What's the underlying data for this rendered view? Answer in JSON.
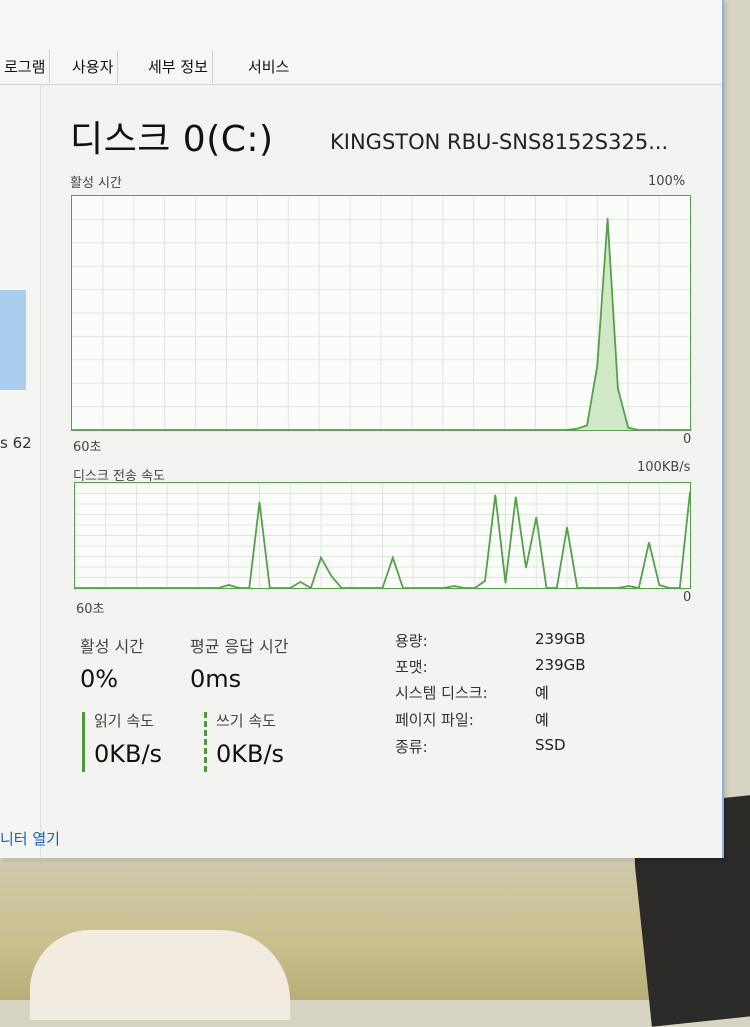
{
  "tabs": [
    "로그램",
    "사용자",
    "세부 정보",
    "서비스"
  ],
  "left_pane_text": "s 62",
  "header": {
    "title": "디스크 0(C:)",
    "model": "KINGSTON RBU-SNS8152S325..."
  },
  "activity_chart": {
    "label": "활성 시간",
    "max_label": "100%",
    "time_label": "60초",
    "min_label": "0"
  },
  "transfer_chart": {
    "label": "디스크 전송 속도",
    "max_label": "100KB/s",
    "time_label": "60초",
    "min_label": "0"
  },
  "chart_data": [
    {
      "type": "area",
      "title": "활성 시간",
      "unit": "%",
      "ylim": [
        0,
        100
      ],
      "x_range_label": "60초",
      "grid": true,
      "values": [
        0,
        0,
        0,
        0,
        0,
        0,
        0,
        0,
        0,
        0,
        0,
        0,
        0,
        0,
        0,
        0,
        0,
        0,
        0,
        0,
        0,
        0,
        0,
        0,
        0,
        0,
        0,
        0,
        0,
        0,
        0,
        0,
        0,
        0,
        0,
        0,
        0,
        0,
        0,
        0,
        0,
        0,
        0,
        0,
        0,
        0,
        0,
        0,
        0,
        0.5,
        2,
        28,
        92,
        18,
        1,
        0,
        0,
        0,
        0,
        0,
        0
      ]
    },
    {
      "type": "line",
      "title": "디스크 전송 속도",
      "unit": "KB/s",
      "ylim": [
        0,
        100
      ],
      "x_range_label": "60초",
      "grid": true,
      "series": [
        {
          "values": [
            0,
            0,
            0,
            0,
            0,
            0,
            0,
            0,
            0,
            0,
            0,
            0,
            0,
            0,
            0,
            3,
            0,
            0,
            85,
            0,
            0,
            0,
            6,
            0,
            30,
            12,
            0,
            0,
            0,
            0,
            0,
            30,
            0,
            0,
            0,
            0,
            0,
            2,
            0,
            0,
            7,
            92,
            5,
            90,
            20,
            70,
            0,
            0,
            60,
            0,
            0,
            0,
            0,
            0,
            2,
            0,
            45,
            3,
            0,
            0,
            95
          ]
        }
      ]
    }
  ],
  "stats": {
    "active_label": "활성 시간",
    "active_value": "0%",
    "resp_label": "평균 응답 시간",
    "resp_value": "0ms",
    "read_label": "읽기 속도",
    "read_value": "0KB/s",
    "write_label": "쓰기 속도",
    "write_value": "0KB/s"
  },
  "info": [
    {
      "label": "용량:",
      "value": "239GB"
    },
    {
      "label": "포맷:",
      "value": "239GB"
    },
    {
      "label": "시스템 디스크:",
      "value": "예"
    },
    {
      "label": "페이지 파일:",
      "value": "예"
    },
    {
      "label": "종류:",
      "value": "SSD"
    }
  ],
  "footer_link": "니터 열기",
  "colors": {
    "graph_line": "#55a04a",
    "graph_fill": "#cfe8c6",
    "accent": "#8db3da"
  }
}
